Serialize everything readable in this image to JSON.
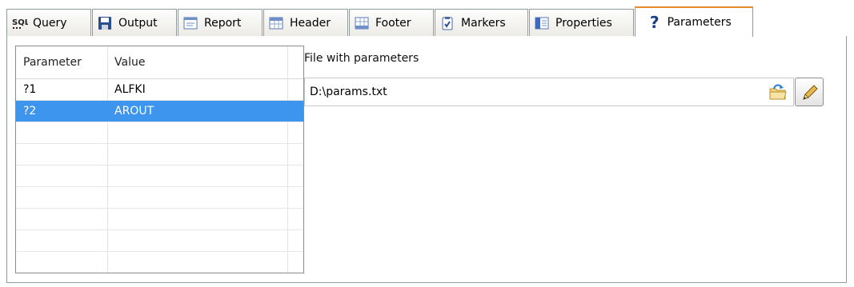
{
  "tabs": [
    {
      "label": "Query",
      "icon": "sql-icon"
    },
    {
      "label": "Output",
      "icon": "floppy-disk-icon"
    },
    {
      "label": "Report",
      "icon": "report-icon"
    },
    {
      "label": "Header",
      "icon": "header-table-icon"
    },
    {
      "label": "Footer",
      "icon": "footer-table-icon"
    },
    {
      "label": "Markers",
      "icon": "clipboard-check-icon"
    },
    {
      "label": "Properties",
      "icon": "properties-icon"
    },
    {
      "label": "Parameters",
      "icon": "question-icon",
      "active": true
    }
  ],
  "sql_icon_text": "SQL",
  "parameters": {
    "columns": [
      "Parameter",
      "Value"
    ],
    "rows": [
      {
        "name": "?1",
        "value": "ALFKI",
        "selected": false
      },
      {
        "name": "?2",
        "value": "AROUT",
        "selected": true
      }
    ]
  },
  "file": {
    "label": "File with parameters",
    "value": "D:\\params.txt"
  },
  "colors": {
    "selection": "#3d95ee",
    "active_tab_accent": "#e68b2c",
    "tab_border": "#919b9c"
  }
}
